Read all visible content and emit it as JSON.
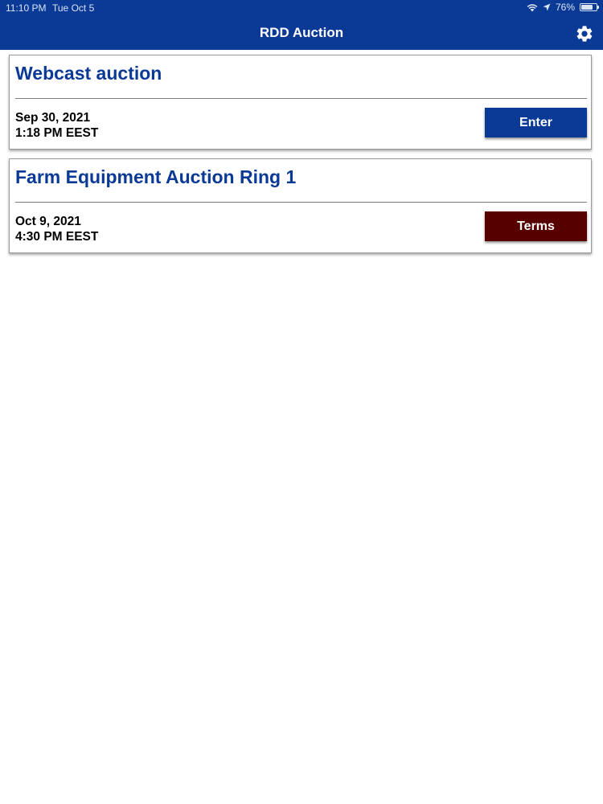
{
  "status_bar": {
    "time": "11:10 PM",
    "date": "Tue Oct 5",
    "battery_text": "76%",
    "battery_level": 0.76,
    "icons": [
      "wifi-icon",
      "location-icon",
      "battery-icon"
    ]
  },
  "nav": {
    "title": "RDD Auction",
    "settings_icon": "gear-icon"
  },
  "colors": {
    "brand_blue": "#0a3a96",
    "enter_button": "#0a3a96",
    "terms_button": "#560000"
  },
  "auctions": [
    {
      "title": "Webcast auction",
      "date": "Sep 30, 2021",
      "time": "1:18 PM EEST",
      "button_label": "Enter"
    },
    {
      "title": "Farm Equipment Auction Ring 1",
      "date": "Oct 9, 2021",
      "time": "4:30 PM EEST",
      "button_label": "Terms"
    }
  ]
}
